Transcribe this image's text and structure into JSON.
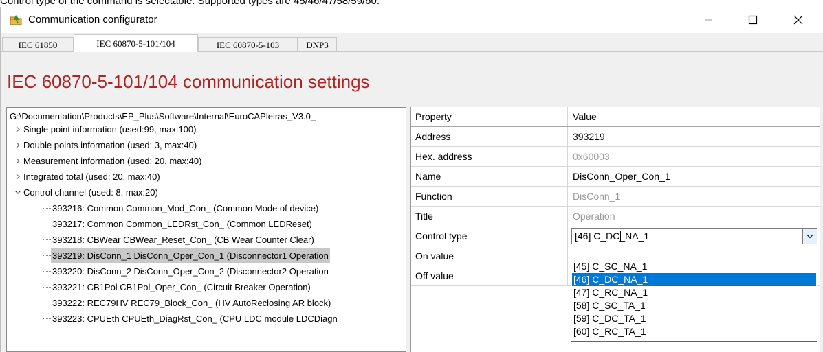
{
  "doc_caption": "Control type of the command is selectable. Supported types are 45/46/47/58/59/60.",
  "window": {
    "title": "Communication configurator",
    "controls": {
      "minimize": "—",
      "maximize": "☐",
      "close": "✕"
    }
  },
  "tabs": [
    {
      "label": "IEC 61850"
    },
    {
      "label": "IEC 60870-5-101/104"
    },
    {
      "label": "IEC 60870-5-103"
    },
    {
      "label": "DNP3"
    }
  ],
  "heading": "IEC 60870-5-101/104 communication settings",
  "tree": {
    "path": "G:\\Documentation\\Products\\EP_Plus\\Software\\Internal\\EuroCAPleiras_V3.0_",
    "nodes": [
      {
        "label": "Single point information (used:99, max:100)",
        "expanded": false
      },
      {
        "label": "Double points information (used: 3, max:40)",
        "expanded": false
      },
      {
        "label": "Measurement information (used: 20, max:40)",
        "expanded": false
      },
      {
        "label": "Integrated total (used: 20, max:40)",
        "expanded": false
      },
      {
        "label": "Control channel (used: 8, max:20)",
        "expanded": true
      }
    ],
    "children": [
      {
        "label": "393216: Common Common_Mod_Con_ (Common Mode of device)",
        "selected": false
      },
      {
        "label": "393217: Common Common_LEDRst_Con_ (Common LEDReset)",
        "selected": false
      },
      {
        "label": "393218: CBWear CBWear_Reset_Con_ (CB Wear Counter Clear)",
        "selected": false
      },
      {
        "label": "393219: DisConn_1 DisConn_Oper_Con_1 (Disconnector1 Operation",
        "selected": true
      },
      {
        "label": "393220: DisConn_2 DisConn_Oper_Con_2 (Disconnector2 Operation",
        "selected": false
      },
      {
        "label": "393221: CB1Pol CB1Pol_Oper_Con_ (Circuit Breaker Operation)",
        "selected": false
      },
      {
        "label": "393222: REC79HV REC79_Block_Con_ (HV AutoReclosing AR block)",
        "selected": false
      },
      {
        "label": "393223: CPUEth CPUEth_DiagRst_Con_ (CPU LDC module LDCDiagn",
        "selected": false
      }
    ]
  },
  "properties": {
    "header": {
      "name": "Property",
      "value": "Value"
    },
    "rows": [
      {
        "name": "Address",
        "value": "393219",
        "muted": false
      },
      {
        "name": "Hex. address",
        "value": "0x60003",
        "muted": true
      },
      {
        "name": "Name",
        "value": "DisConn_Oper_Con_1",
        "muted": false
      },
      {
        "name": "Function",
        "value": "DisConn_1",
        "muted": true
      },
      {
        "name": "Title",
        "value": "Operation",
        "muted": true
      },
      {
        "name": "Control type",
        "value": "[46] C_DC_NA_1",
        "muted": false
      },
      {
        "name": "On value",
        "value": "",
        "muted": false
      },
      {
        "name": "Off value",
        "value": "",
        "muted": false
      }
    ]
  },
  "control_type_options": [
    {
      "label": "[45] C_SC_NA_1",
      "selected": false
    },
    {
      "label": "[46] C_DC_NA_1",
      "selected": true
    },
    {
      "label": "[47] C_RC_NA_1",
      "selected": false
    },
    {
      "label": "[58] C_SC_TA_1",
      "selected": false
    },
    {
      "label": "[59] C_DC_TA_1",
      "selected": false
    },
    {
      "label": "[60] C_RC_TA_1",
      "selected": false
    }
  ],
  "colors": {
    "heading": "#b22222",
    "selection": "#0078d7",
    "tree_selection": "#c8c8c8"
  },
  "icons": {
    "app": "configurator-icon",
    "collapsed": "chevron-right-icon",
    "expanded": "chevron-down-icon",
    "dropdown": "chevron-down-icon"
  }
}
